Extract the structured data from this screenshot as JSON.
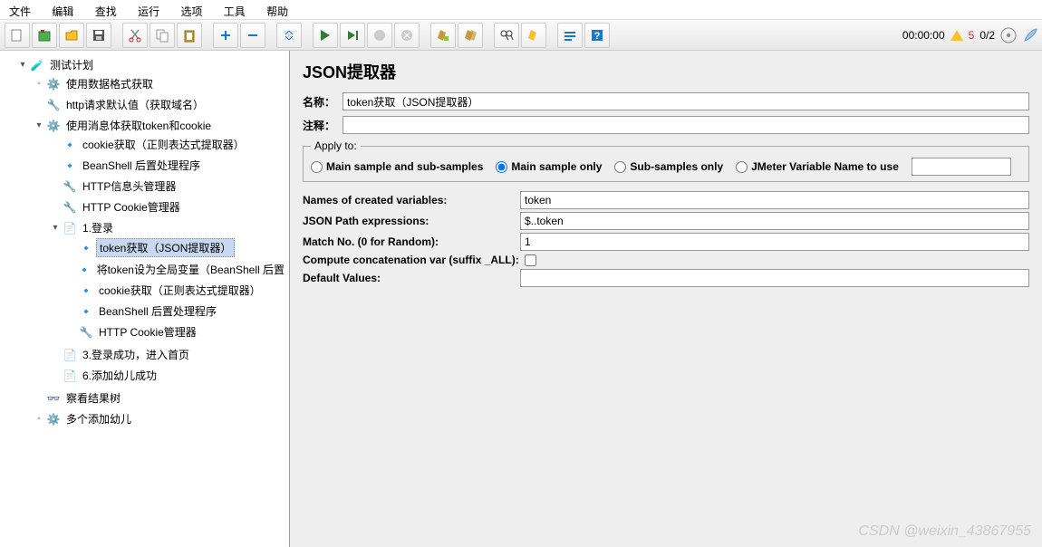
{
  "menu": [
    "文件",
    "编辑",
    "查找",
    "运行",
    "选项",
    "工具",
    "帮助"
  ],
  "status": {
    "time": "00:00:00",
    "warn_count": "5",
    "ratio": "0/2"
  },
  "tree": {
    "root": "测试计划",
    "n1": "使用数据格式获取",
    "n2": "http请求默认值（获取域名）",
    "n3": "使用消息体获取token和cookie",
    "n3a": "cookie获取（正则表达式提取器）",
    "n3b": "BeanShell 后置处理程序",
    "n3c": "HTTP信息头管理器",
    "n3d": "HTTP Cookie管理器",
    "n3e": "1.登录",
    "n3e1": "token获取（JSON提取器）",
    "n3e2": "将token设为全局变量（BeanShell 后置",
    "n3e3": "cookie获取（正则表达式提取器）",
    "n3e4": "BeanShell 后置处理程序",
    "n3e5": "HTTP Cookie管理器",
    "n3f": "3.登录成功，进入首页",
    "n3g": "6.添加幼儿成功",
    "n4": "察看结果树",
    "n5": "多个添加幼儿"
  },
  "panel": {
    "title": "JSON提取器",
    "name_label": "名称：",
    "name_value": "token获取（JSON提取器）",
    "comment_label": "注释：",
    "comment_value": "",
    "apply_legend": "Apply to:",
    "radio": {
      "r1": "Main sample and sub-samples",
      "r2": "Main sample only",
      "r3": "Sub-samples only",
      "r4": "JMeter Variable Name to use"
    },
    "varname_value": "",
    "rows": {
      "l1": "Names of created variables:",
      "v1": "token",
      "l2": "JSON Path expressions:",
      "v2": "$..token",
      "l3": "Match No. (0 for Random):",
      "v3": "1",
      "concat_label": "Compute concatenation var (suffix _ALL):",
      "l4": "Default Values:",
      "v4": ""
    }
  },
  "watermark": "CSDN @weixin_43867955"
}
